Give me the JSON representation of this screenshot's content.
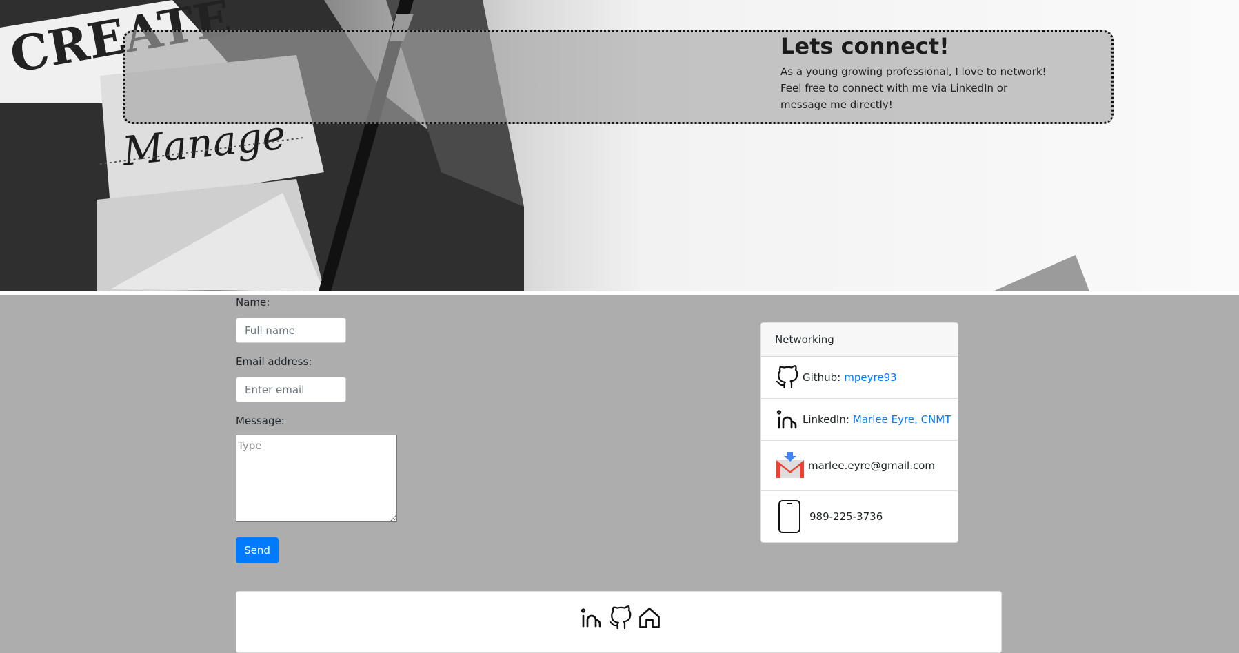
{
  "hero": {
    "title": "Lets connect!",
    "text": "As a young growing professional, I love to network! Feel free to connect with me via LinkedIn or message me directly!",
    "art_words": [
      "CREATE",
      "Manage"
    ]
  },
  "form": {
    "name_label": "Name:",
    "name_placeholder": "Full name",
    "email_label": "Email address:",
    "email_placeholder": "Enter email",
    "message_label": "Message:",
    "message_placeholder": "Type",
    "send_label": "Send"
  },
  "networking": {
    "header": "Networking",
    "github_label": "Github:",
    "github_link": "mpeyre93",
    "linkedin_label": "LinkedIn:",
    "linkedin_link": "Marlee Eyre, CNMT",
    "email": "marlee.eyre@gmail.com",
    "phone": "989-225-3736"
  },
  "footer": {
    "icons": [
      "linkedin-icon",
      "github-icon",
      "home-icon"
    ]
  },
  "colors": {
    "accent": "#007bff",
    "page_bg": "#adadad",
    "gmail_red": "#ea4335",
    "gmail_blue": "#4285f4"
  }
}
